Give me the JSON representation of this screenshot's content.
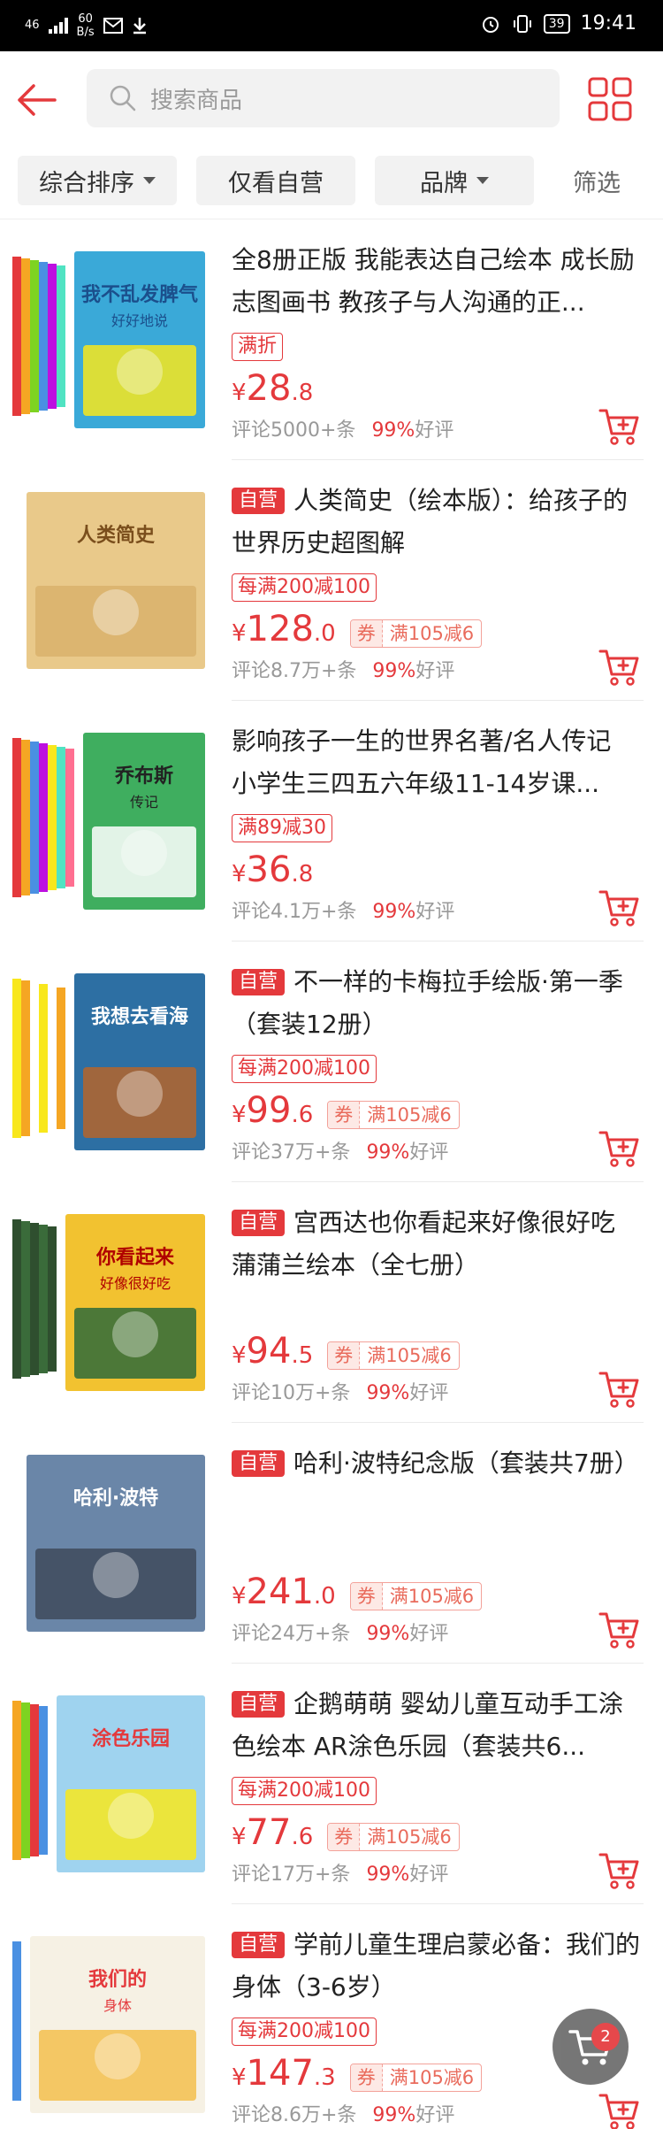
{
  "status_bar": {
    "network": "46",
    "speed_value": "60",
    "speed_unit": "B/s",
    "battery": "39",
    "time": "19:41"
  },
  "search": {
    "placeholder": "搜索商品"
  },
  "filters": {
    "sort": "综合排序",
    "self_only": "仅看自营",
    "brand": "品牌",
    "filter": "筛选"
  },
  "self_label": "自营",
  "coupon_label": "券",
  "rating_suffix": "好评",
  "products": [
    {
      "title": "全8册正版 我能表达自己绘本 成长励志图画书 教孩子与人沟通的正...",
      "self_operated": false,
      "promo": "满折",
      "price_int": "28",
      "price_dec": ".8",
      "coupon": "",
      "reviews": "评论5000+条",
      "rate": "99%",
      "cover_title": "我不乱发脾气",
      "cover_sub": "好好地说"
    },
    {
      "title": "人类简史（绘本版）：给孩子的世界历史超图解",
      "self_operated": true,
      "promo": "每满200减100",
      "price_int": "128",
      "price_dec": ".0",
      "coupon": "满105减6",
      "reviews": "评论8.7万+条",
      "rate": "99%",
      "cover_title": "人类简史",
      "cover_sub": ""
    },
    {
      "title": "影响孩子一生的世界名著/名人传记  小学生三四五六年级11-14岁课...",
      "self_operated": false,
      "promo": "满89减30",
      "price_int": "36",
      "price_dec": ".8",
      "coupon": "",
      "reviews": "评论4.1万+条",
      "rate": "99%",
      "cover_title": "乔布斯",
      "cover_sub": "传记"
    },
    {
      "title": "不一样的卡梅拉手绘版·第一季（套装12册）",
      "self_operated": true,
      "promo": "每满200减100",
      "price_int": "99",
      "price_dec": ".6",
      "coupon": "满105减6",
      "reviews": "评论37万+条",
      "rate": "99%",
      "cover_title": "我想去看海",
      "cover_sub": ""
    },
    {
      "title": "宫西达也你看起来好像很好吃 蒲蒲兰绘本（全七册）",
      "self_operated": true,
      "promo": "",
      "price_int": "94",
      "price_dec": ".5",
      "coupon": "满105减6",
      "reviews": "评论10万+条",
      "rate": "99%",
      "cover_title": "你看起来",
      "cover_sub": "好像很好吃"
    },
    {
      "title": "哈利·波特纪念版（套装共7册）",
      "self_operated": true,
      "promo": "",
      "price_int": "241",
      "price_dec": ".0",
      "coupon": "满105减6",
      "reviews": "评论24万+条",
      "rate": "99%",
      "cover_title": "哈利·波特",
      "cover_sub": ""
    },
    {
      "title": "企鹅萌萌 婴幼儿童互动手工涂色绘本 AR涂色乐园（套装共6...",
      "self_operated": true,
      "promo": "每满200减100",
      "price_int": "77",
      "price_dec": ".6",
      "coupon": "满105减6",
      "reviews": "评论17万+条",
      "rate": "99%",
      "cover_title": "涂色乐园",
      "cover_sub": ""
    },
    {
      "title": "学前儿童生理启蒙必备：我们的身体（3-6岁）",
      "self_operated": true,
      "promo": "每满200减100",
      "price_int": "147",
      "price_dec": ".3",
      "coupon": "满105减6",
      "reviews": "评论8.6万+条",
      "rate": "99%",
      "cover_title": "我们的",
      "cover_sub": "身体"
    }
  ],
  "cart_count": "2",
  "colors": {
    "accent": "#e4393c",
    "coupon": "#e96b5c"
  }
}
